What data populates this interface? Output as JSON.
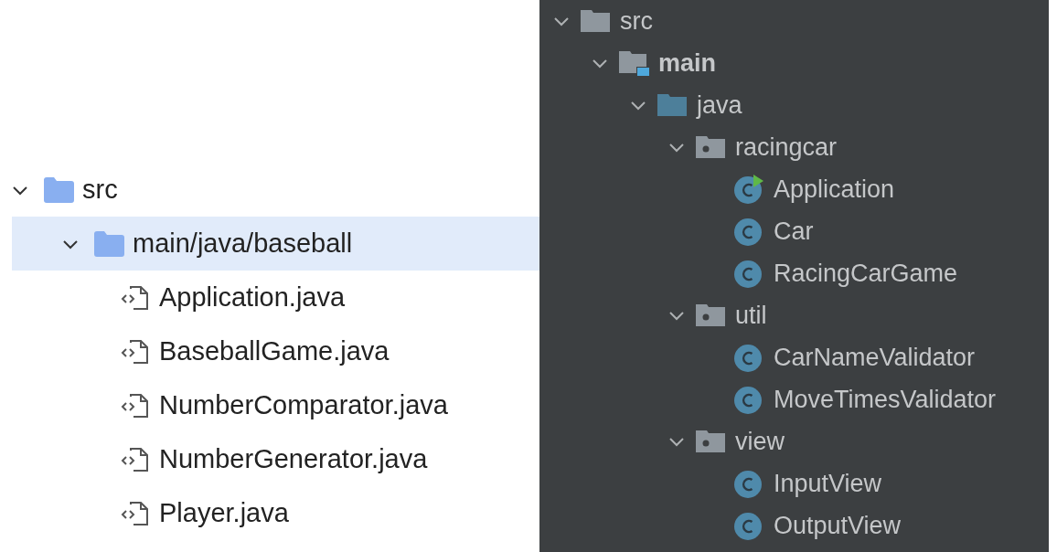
{
  "left_tree": [
    {
      "kind": "folder",
      "label": "src",
      "expanded": true,
      "selected": false,
      "children": [
        {
          "kind": "folder",
          "label": "main/java/baseball",
          "expanded": true,
          "selected": true,
          "children": [
            {
              "kind": "file",
              "label": "Application.java",
              "selected": false
            },
            {
              "kind": "file",
              "label": "BaseballGame.java",
              "selected": false
            },
            {
              "kind": "file",
              "label": "NumberComparator.java",
              "selected": false
            },
            {
              "kind": "file",
              "label": "NumberGenerator.java",
              "selected": false
            },
            {
              "kind": "file",
              "label": "Player.java",
              "selected": false
            }
          ]
        }
      ]
    }
  ],
  "right_tree": [
    {
      "kind": "folder",
      "label": "src",
      "expanded": true,
      "children": [
        {
          "kind": "source_root",
          "label": "main",
          "expanded": true,
          "children": [
            {
              "kind": "sources",
              "label": "java",
              "expanded": true,
              "children": [
                {
                  "kind": "package",
                  "label": "racingcar",
                  "expanded": true,
                  "children": [
                    {
                      "kind": "class",
                      "label": "Application",
                      "runnable": true
                    },
                    {
                      "kind": "class",
                      "label": "Car",
                      "runnable": false
                    },
                    {
                      "kind": "class",
                      "label": "RacingCarGame",
                      "runnable": false
                    }
                  ]
                },
                {
                  "kind": "package",
                  "label": "util",
                  "expanded": true,
                  "children": [
                    {
                      "kind": "class",
                      "label": "CarNameValidator",
                      "runnable": false
                    },
                    {
                      "kind": "class",
                      "label": "MoveTimesValidator",
                      "runnable": false
                    }
                  ]
                },
                {
                  "kind": "package",
                  "label": "view",
                  "expanded": true,
                  "children": [
                    {
                      "kind": "class",
                      "label": "InputView",
                      "runnable": false
                    },
                    {
                      "kind": "class",
                      "label": "OutputView",
                      "runnable": false
                    }
                  ]
                }
              ]
            }
          ]
        }
      ]
    }
  ]
}
